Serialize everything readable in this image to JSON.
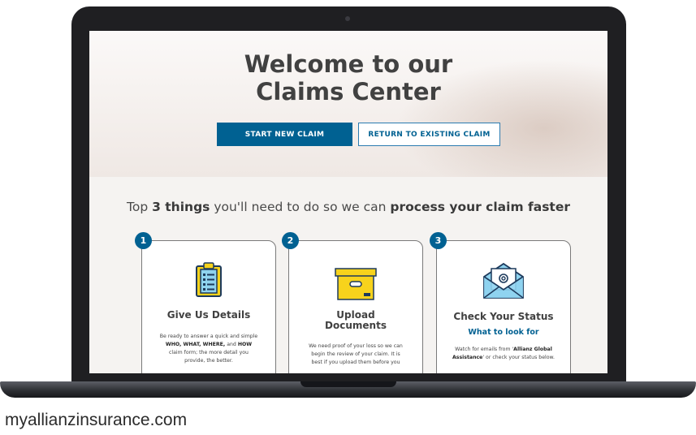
{
  "hero": {
    "title_line1": "Welcome to our",
    "title_line2": "Claims Center",
    "primary_button": "START NEW CLAIM",
    "secondary_button": "RETURN TO EXISTING CLAIM"
  },
  "section": {
    "title_part1": "Top ",
    "title_bold1": "3 things",
    "title_part2": " you'll need to do so we can ",
    "title_bold2": "process your claim faster"
  },
  "cards": [
    {
      "number": "1",
      "icon": "clipboard-checklist-icon",
      "title": "Give Us Details",
      "body_1": "Be ready to answer a quick and simple",
      "body_2_bold": "WHO, WHAT, WHERE,",
      "body_2_mid": " and ",
      "body_2_bold2": "HOW",
      "body_3": "claim form; the more detail you",
      "body_4": "provide, the better."
    },
    {
      "number": "2",
      "icon": "document-box-icon",
      "title_line1": "Upload",
      "title_line2": "Documents",
      "body_1": "We need proof of your loss so we can",
      "body_2": "begin the review of your claim. It is",
      "body_3": "best if you upload them before you"
    },
    {
      "number": "3",
      "icon": "email-envelope-icon",
      "title": "Check Your Status",
      "subtitle": "What to look for",
      "body_1_pre": "Watch for emails from '",
      "body_1_bold": "Allianz Global",
      "body_2_bold": "Assistance",
      "body_2_post": "' or check your status below."
    }
  ],
  "caption": "myallianzinsurance.com",
  "colors": {
    "brand_blue": "#006192",
    "icon_yellow": "#f7d31c",
    "icon_light_blue": "#8fd3ef",
    "frame": "#1f1f22"
  }
}
